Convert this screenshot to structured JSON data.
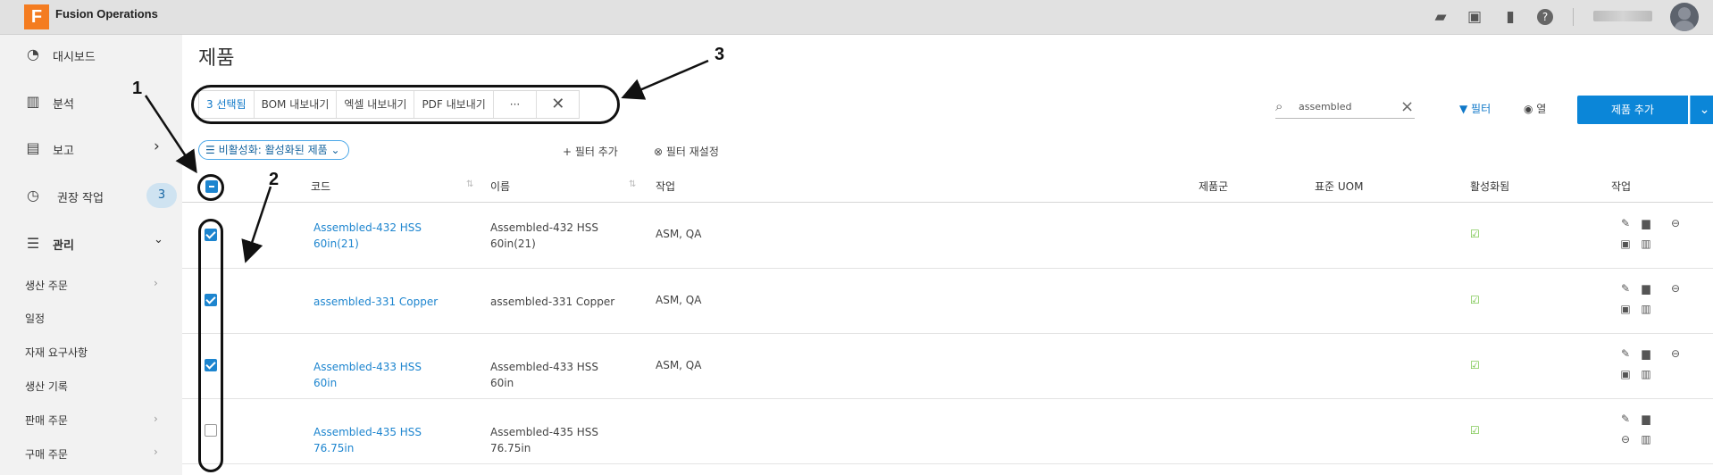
{
  "app": {
    "title": "Fusion Operations",
    "logo_letter": "F"
  },
  "topbar": {
    "icons": [
      "chat-icon",
      "tasks-icon",
      "bookmark-icon",
      "help-icon"
    ],
    "user_name": ""
  },
  "sidebar": {
    "items": [
      {
        "label": "대시보드",
        "icon": "dashboard-icon"
      },
      {
        "label": "분석",
        "icon": "analytics-icon"
      },
      {
        "label": "보고",
        "icon": "report-icon"
      },
      {
        "label": "권장 작업",
        "icon": "history-icon",
        "badge": "3"
      },
      {
        "label": "관리",
        "icon": "settings-sliders-icon"
      }
    ],
    "sub_items": [
      {
        "label": "생산 주문"
      },
      {
        "label": "일정"
      },
      {
        "label": "자재 요구사항"
      },
      {
        "label": "생산 기록"
      },
      {
        "label": "판매 주문"
      },
      {
        "label": "구매 주문"
      }
    ]
  },
  "page": {
    "title": "제품"
  },
  "action_bar": {
    "selected": "3 선택됨",
    "bom": "BOM 내보내기",
    "excel": "엑셀 내보내기",
    "pdf": "PDF 내보내기",
    "more": "···",
    "close": "✕"
  },
  "callouts": {
    "one": "1",
    "two": "2",
    "three": "3"
  },
  "search": {
    "value": "assembled"
  },
  "toolbar": {
    "filter": "필터",
    "columns": "열",
    "add_product": "제품 추가"
  },
  "filters": {
    "chip": "비활성화: 활성화된 제품",
    "add": "+ 필터 추가",
    "reset": "필터 재설정"
  },
  "table": {
    "headers": {
      "code": "코드",
      "name": "이름",
      "work": "작업",
      "group": "제품군",
      "uom": "표준 UOM",
      "active": "활성화됨",
      "actions": "작업"
    },
    "rows": [
      {
        "checked": true,
        "code": "Assembled-432 HSS 60in(21)",
        "name": "Assembled-432 HSS 60in(21)",
        "work": "ASM, QA",
        "active": true
      },
      {
        "checked": true,
        "code": "assembled-331 Copper",
        "name": "assembled-331 Copper",
        "work": "ASM, QA",
        "active": true
      },
      {
        "checked": true,
        "code": "Assembled-433 HSS 60in",
        "name": "Assembled-433 HSS 60in",
        "work": "ASM, QA",
        "active": true
      },
      {
        "checked": false,
        "code": "Assembled-435 HSS 76.75in",
        "name": "Assembled-435 HSS 76.75in",
        "work": "",
        "active": true
      }
    ]
  },
  "colors": {
    "accent": "#0b86d8",
    "link": "#1d85cf",
    "logo": "#f47c20",
    "active": "#6bbf3a"
  }
}
